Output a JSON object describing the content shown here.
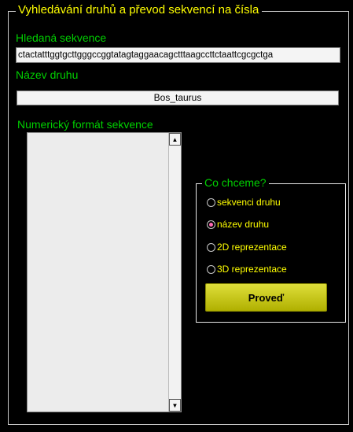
{
  "panel": {
    "title": "Vyhledávání druhů a převod sekvencí na čísla"
  },
  "sequence": {
    "label": "Hledaná sekvence",
    "value": "ctactatttggtgcttgggccggtatagtaggaacagctttaagccttctaattcgcgctga"
  },
  "species": {
    "label": "Název druhu",
    "value": "Bos_taurus"
  },
  "numeric": {
    "label": "Numerický formát sekvence",
    "scroll_up_icon": "arrow-up-icon",
    "scroll_down_icon": "arrow-down-icon"
  },
  "choice": {
    "title": "Co chceme?",
    "options": [
      {
        "label": "sekvenci druhu",
        "checked": false
      },
      {
        "label": "název druhu",
        "checked": true
      },
      {
        "label": "2D reprezentace",
        "checked": false
      },
      {
        "label": "3D reprezentace",
        "checked": false
      }
    ],
    "button_label": "Proveď"
  },
  "colors": {
    "background": "#000000",
    "title": "#ffff00",
    "label": "#00d000",
    "radio_text": "#ffff00",
    "button": "#c8c820",
    "selected_dot": "#ff69b4"
  }
}
